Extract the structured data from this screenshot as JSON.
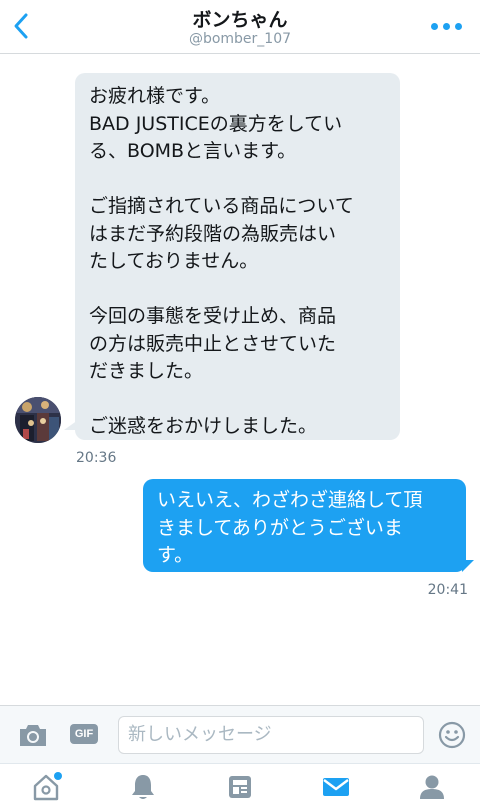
{
  "header": {
    "title": "ボンちゃん",
    "handle": "@bomber_107",
    "back_icon": "chevron-left-icon",
    "more_icon": "more-dots-icon"
  },
  "messages": [
    {
      "direction": "incoming",
      "paragraphs": [
        "お疲れ様です。\nBAD JUSTICEの裏方をしてい\nる、BOMBと言います。",
        "ご指摘されている商品について\nはまだ予約段階の為販売はい\nたしておりません。",
        "今回の事態を受け止め、商品\nの方は販売中止とさせていた\nだきました。",
        "ご迷惑をおかけしました。"
      ],
      "time": "20:36"
    },
    {
      "direction": "outgoing",
      "text": "いえいえ、わざわざ連絡して頂\nきましてありがとうございま\nす。",
      "time": "20:41"
    }
  ],
  "composer": {
    "camera_icon": "camera-icon",
    "gif_label": "GIF",
    "placeholder": "新しいメッセージ",
    "emoji_icon": "smiley-icon"
  },
  "tabbar": {
    "items": [
      "home-icon",
      "bell-icon",
      "moments-icon",
      "mail-icon",
      "profile-icon"
    ],
    "active": "mail-icon"
  },
  "colors": {
    "accent": "#1da1f2",
    "incoming_bubble": "#e6ecf0",
    "muted": "#8899a6"
  }
}
